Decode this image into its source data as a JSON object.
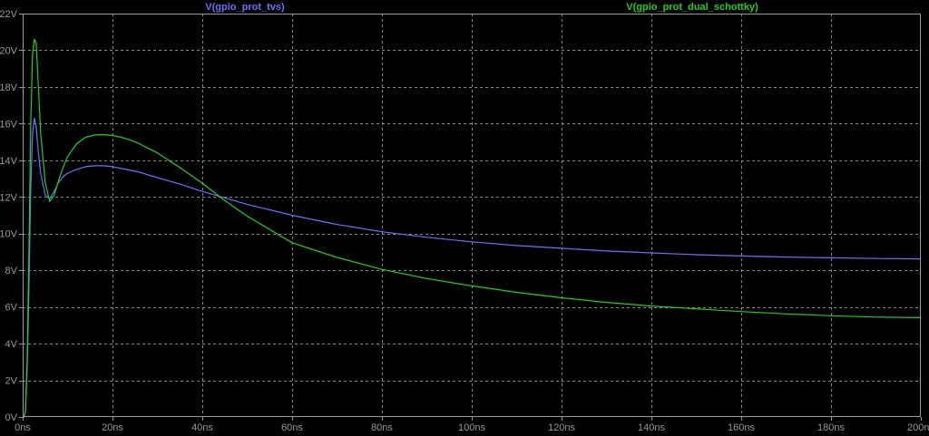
{
  "chart_data": {
    "type": "line",
    "x_unit": "ns",
    "y_unit": "V",
    "xlim": [
      0,
      200
    ],
    "ylim": [
      0,
      22
    ],
    "x_ticks": [
      0,
      20,
      40,
      60,
      80,
      100,
      120,
      140,
      160,
      180,
      200
    ],
    "x_tick_labels": [
      "0ns",
      "20ns",
      "40ns",
      "60ns",
      "80ns",
      "100ns",
      "120ns",
      "140ns",
      "160ns",
      "180ns",
      "200ns"
    ],
    "y_ticks": [
      0,
      2,
      4,
      6,
      8,
      10,
      12,
      14,
      16,
      18,
      20,
      22
    ],
    "y_tick_labels": [
      "0V",
      "2V",
      "4V",
      "6V",
      "8V",
      "10V",
      "12V",
      "14V",
      "16V",
      "18V",
      "20V",
      "22V"
    ],
    "grid": true,
    "legend_position": "top",
    "series": [
      {
        "name": "V(gpio_prot_tvs)",
        "color": "#7070ff",
        "x": [
          0,
          0.3,
          0.6,
          1.0,
          1.4,
          1.8,
          2.2,
          2.6,
          3.0,
          3.5,
          4,
          5,
          6,
          7,
          8,
          9,
          10,
          12,
          14,
          16,
          18,
          20,
          22,
          24,
          26,
          28,
          30,
          35,
          40,
          45,
          50,
          60,
          70,
          80,
          90,
          100,
          110,
          120,
          130,
          140,
          150,
          160,
          170,
          180,
          190,
          200
        ],
        "y": [
          0,
          0,
          0.3,
          2.5,
          7.0,
          12.5,
          15.5,
          16.3,
          15.8,
          14.4,
          13.3,
          12.1,
          11.9,
          12.3,
          12.8,
          13.1,
          13.3,
          13.5,
          13.65,
          13.7,
          13.7,
          13.65,
          13.55,
          13.45,
          13.35,
          13.2,
          13.05,
          12.7,
          12.3,
          11.95,
          11.6,
          11.0,
          10.5,
          10.1,
          9.8,
          9.55,
          9.35,
          9.2,
          9.05,
          8.95,
          8.85,
          8.78,
          8.72,
          8.68,
          8.64,
          8.62
        ]
      },
      {
        "name": "V(gpio_prot_dual_schottky)",
        "color": "#20d020",
        "x": [
          0,
          0.3,
          0.6,
          1.0,
          1.4,
          1.8,
          2.2,
          2.6,
          3.0,
          3.5,
          4,
          5,
          6,
          7,
          8,
          9,
          10,
          12,
          14,
          16,
          18,
          20,
          22,
          24,
          26,
          28,
          30,
          35,
          40,
          45,
          50,
          60,
          70,
          80,
          90,
          100,
          110,
          120,
          130,
          140,
          150,
          160,
          170,
          180,
          190,
          200
        ],
        "y": [
          0,
          0,
          0.3,
          3.0,
          9.0,
          16.0,
          19.8,
          20.6,
          20.4,
          18.0,
          15.5,
          12.8,
          11.75,
          12.1,
          12.9,
          13.6,
          14.2,
          14.9,
          15.25,
          15.38,
          15.4,
          15.35,
          15.25,
          15.1,
          14.9,
          14.65,
          14.4,
          13.6,
          12.75,
          11.8,
          10.95,
          9.5,
          8.7,
          8.05,
          7.55,
          7.15,
          6.8,
          6.5,
          6.25,
          6.05,
          5.9,
          5.75,
          5.62,
          5.52,
          5.45,
          5.42
        ]
      }
    ]
  }
}
